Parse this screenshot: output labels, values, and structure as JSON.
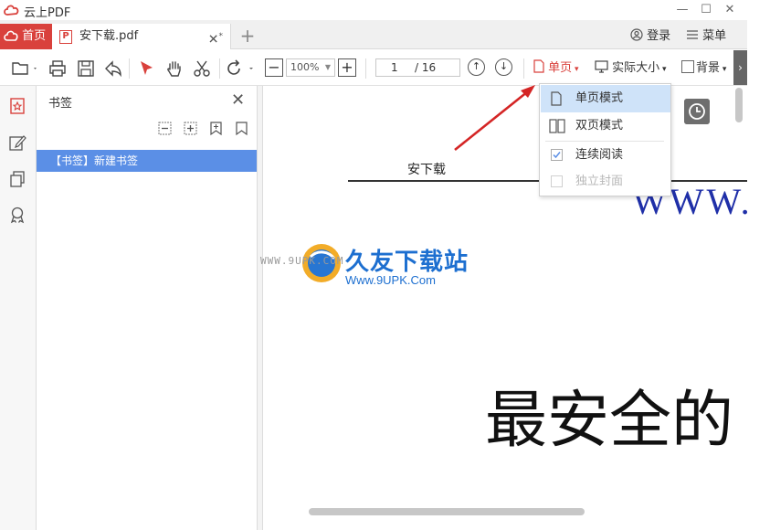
{
  "titlebar": {
    "app_title": "云上PDF",
    "minimize": "—",
    "maximize": "☐",
    "close": "✕"
  },
  "tabs": {
    "home_label": "首页",
    "doc_icon_letter": "P",
    "doc_label": "安下载.pdf",
    "doc_close": "✕",
    "doc_modified": "*",
    "add": "+"
  },
  "header_right": {
    "login_label": "登录",
    "menu_label": "菜单"
  },
  "toolbar": {
    "zoom_minus": "−",
    "zoom_value": "100%",
    "zoom_plus": "+",
    "page_current": "1",
    "page_total": "/ 16",
    "single_page_label": "单页",
    "actual_size_label": "实际大小",
    "background_label": "背景",
    "more": "›"
  },
  "bookmark_panel": {
    "title": "书签",
    "close": "✕",
    "items": [
      {
        "label": "【书签】新建书签"
      }
    ]
  },
  "document": {
    "header_text": "安下载",
    "www_text": "WWW.",
    "big_text": "最安全的"
  },
  "watermark": {
    "small_text": "WWW.9UPK.COM",
    "brand_text": "久友下载站",
    "url_text": "Www.9UPK.Com"
  },
  "view_menu": {
    "items": [
      {
        "label": "单页模式",
        "icon": "single-page-icon",
        "state": "active"
      },
      {
        "label": "双页模式",
        "icon": "double-page-icon",
        "state": "normal"
      },
      {
        "label": "连续阅读",
        "icon": "checkbox-checked",
        "state": "checked"
      },
      {
        "label": "独立封面",
        "icon": "checkbox-empty",
        "state": "disabled"
      }
    ]
  },
  "colors": {
    "accent_red": "#d9413c",
    "selection_blue": "#5b8fe6",
    "menu_highlight": "#cfe3f9",
    "www_blue": "#1f2fa8"
  }
}
